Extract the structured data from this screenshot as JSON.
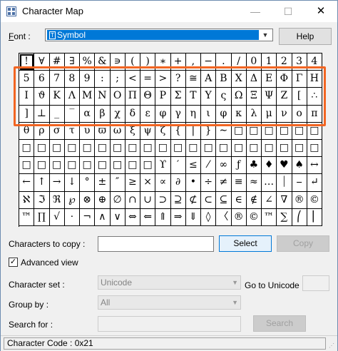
{
  "window": {
    "title": "Character Map",
    "minimize": "—",
    "maximize": "☐",
    "close": "✕"
  },
  "font": {
    "label_prefix": "F",
    "label_rest": "ont :",
    "value": "Symbol",
    "help": "Help"
  },
  "grid": [
    [
      "!",
      "∀",
      "#",
      "∃",
      "%",
      "&",
      "∍",
      "(",
      ")",
      "∗",
      "+",
      ",",
      "−",
      ".",
      "/",
      "0",
      "1",
      "2",
      "3",
      "4"
    ],
    [
      "5",
      "6",
      "7",
      "8",
      "9",
      ":",
      ";",
      "<",
      "=",
      ">",
      "?",
      "≅",
      "Α",
      "Β",
      "Χ",
      "Δ",
      "Ε",
      "Φ",
      "Γ",
      "Η"
    ],
    [
      "Ι",
      "ϑ",
      "Κ",
      "Λ",
      "Μ",
      "Ν",
      "Ο",
      "Π",
      "Θ",
      "Ρ",
      "Σ",
      "Τ",
      "Υ",
      "ς",
      "Ω",
      "Ξ",
      "Ψ",
      "Ζ",
      "[",
      "∴"
    ],
    [
      "]",
      "⊥",
      "_",
      "‾",
      "α",
      "β",
      "χ",
      "δ",
      "ε",
      "φ",
      "γ",
      "η",
      "ι",
      "φ",
      "κ",
      "λ",
      "μ",
      "ν",
      "ο",
      "π"
    ],
    [
      "θ",
      "ρ",
      "σ",
      "τ",
      "υ",
      "ϖ",
      "ω",
      "ξ",
      "ψ",
      "ζ",
      "{",
      "|",
      "}",
      "∼",
      "□",
      "□",
      "□",
      "□",
      "□",
      "□"
    ],
    [
      "□",
      "□",
      "□",
      "□",
      "□",
      "□",
      "□",
      "□",
      "□",
      "□",
      "□",
      "□",
      "□",
      "□",
      "□",
      "□",
      "□",
      "□",
      "□",
      "□"
    ],
    [
      "□",
      "□",
      "□",
      "□",
      "□",
      "□",
      "□",
      "□",
      "□",
      "ϒ",
      "′",
      "≤",
      "⁄",
      "∞",
      "ƒ",
      "♣",
      "♦",
      "♥",
      "♠",
      "↔"
    ],
    [
      "←",
      "↑",
      "→",
      "↓",
      "°",
      "±",
      "″",
      "≥",
      "×",
      "∝",
      "∂",
      "•",
      "÷",
      "≠",
      "≡",
      "≈",
      "…",
      "⏐",
      "⎯",
      "↵"
    ],
    [
      "ℵ",
      "ℑ",
      "ℜ",
      "℘",
      "⊗",
      "⊕",
      "∅",
      "∩",
      "∪",
      "⊃",
      "⊇",
      "⊄",
      "⊂",
      "⊆",
      "∈",
      "∉",
      "∠",
      "∇",
      "®",
      "©"
    ],
    [
      "™",
      "∏",
      "√",
      "⋅",
      "¬",
      "∧",
      "∨",
      "⇔",
      "⇐",
      "⇑",
      "⇒",
      "⇓",
      "◊",
      "〈",
      "®",
      "©",
      "™",
      "∑",
      "⎛",
      "⎜"
    ]
  ],
  "controls": {
    "chars_to_copy_label": "Characters to copy :",
    "chars_to_copy_value": "",
    "select": "Select",
    "copy": "Copy",
    "advanced_view": "Advanced view",
    "advanced_checked": true,
    "charset_label": "Character set :",
    "charset_value": "Unicode",
    "goto_label": "Go to Unicode :",
    "goto_value": "",
    "groupby_label": "Group by :",
    "groupby_value": "All",
    "search_label": "Search for :",
    "search_value": "",
    "search_button": "Search"
  },
  "status": {
    "text": "Character Code : 0x21"
  },
  "colors": {
    "highlight": "#f26522",
    "selection": "#0078d7"
  }
}
